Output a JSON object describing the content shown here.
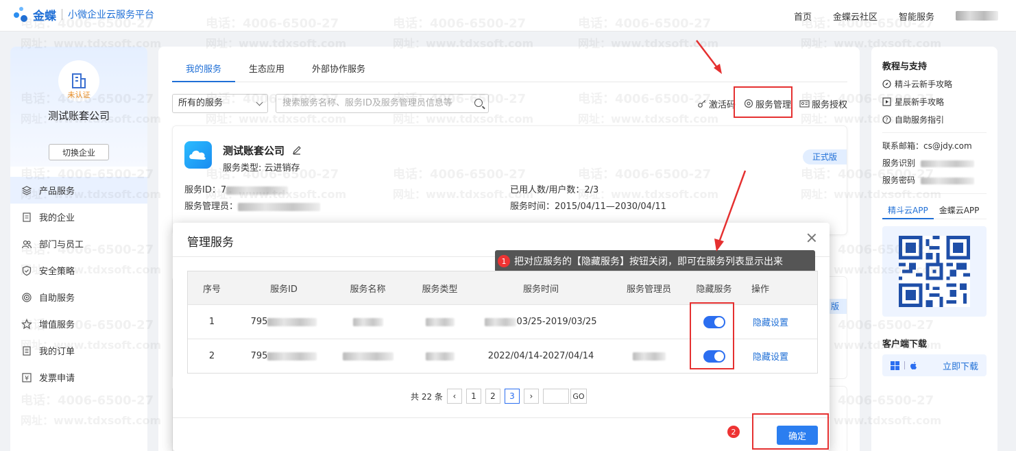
{
  "topbar": {
    "brand": "金蝶",
    "platform": "小微企业云服务平台",
    "nav": [
      "首页",
      "金蝶云社区",
      "智能服务"
    ]
  },
  "sidebar": {
    "status": "未认证",
    "company": "测试账套公司",
    "switch_label": "切换企业",
    "items": [
      {
        "label": "产品服务",
        "icon": "layers-icon"
      },
      {
        "label": "我的企业",
        "icon": "document-icon"
      },
      {
        "label": "部门与员工",
        "icon": "users-icon"
      },
      {
        "label": "安全策略",
        "icon": "shield-icon"
      },
      {
        "label": "自助服务",
        "icon": "target-icon"
      },
      {
        "label": "增值服务",
        "icon": "star-icon"
      },
      {
        "label": "我的订单",
        "icon": "list-icon"
      },
      {
        "label": "发票申请",
        "icon": "yen-icon"
      }
    ]
  },
  "main": {
    "tabs": [
      "我的服务",
      "生态应用",
      "外部协作服务"
    ],
    "filter_select": "所有的服务",
    "search_placeholder": "搜索服务名称、服务ID及服务管理员信息等",
    "actions": [
      "激活码",
      "服务管理",
      "服务授权"
    ],
    "card": {
      "name": "测试账套公司",
      "type_label": "服务类型: 云进销存",
      "badge": "正式版",
      "id_label": "服务ID：",
      "id_prefix": "7",
      "admin_label": "服务管理员：",
      "users_label": "已用人数/用户数：2/3",
      "time_label": "服务时间：2015/04/11—2030/04/11"
    },
    "ghost_badge": "版"
  },
  "modal": {
    "title": "管理服务",
    "tooltip_num": "1",
    "tooltip": "把对应服务的【隐藏服务】按钮关闭，即可在服务列表显示出来",
    "columns": [
      "序号",
      "服务ID",
      "服务名称",
      "服务类型",
      "服务时间",
      "服务管理员",
      "隐藏服务",
      "操作"
    ],
    "rows": [
      {
        "index": "1",
        "id_prefix": "795",
        "time": "03/25-2019/03/25",
        "action": "隐藏设置",
        "hidden": true
      },
      {
        "index": "2",
        "id_prefix": "795",
        "time": "2022/04/14-2027/04/14",
        "action": "隐藏设置",
        "hidden": true
      }
    ],
    "pager": {
      "total": "共 22 条",
      "pages": [
        "1",
        "2",
        "3"
      ],
      "current": "3",
      "go": "GO"
    },
    "confirm_num": "2",
    "confirm": "确定"
  },
  "right": {
    "support_title": "教程与支持",
    "links": [
      {
        "label": "精斗云新手攻略",
        "icon": "compass-icon"
      },
      {
        "label": "星辰新手攻略",
        "icon": "play-icon"
      },
      {
        "label": "自助服务指引",
        "icon": "help-icon"
      }
    ],
    "email": "联系邮箱：cs@jdy.com",
    "service_id_label": "服务识别",
    "service_pw_label": "服务密码",
    "app_tabs": [
      "精斗云APP",
      "金蝶云APP"
    ],
    "download_title": "客户端下载",
    "download_link": "立即下载"
  },
  "watermark": {
    "phone": "电话：4006-6500-27",
    "site": "网址：www.tdxsoft.com"
  },
  "colors": {
    "accent": "#1f6fd6",
    "highlight": "#e53030",
    "toggle": "#2b6ef0"
  }
}
